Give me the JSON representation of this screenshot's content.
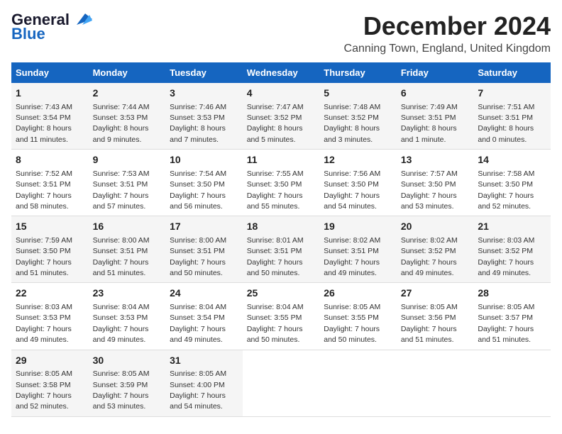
{
  "logo": {
    "line1": "General",
    "line2": "Blue"
  },
  "title": "December 2024",
  "location": "Canning Town, England, United Kingdom",
  "headers": [
    "Sunday",
    "Monday",
    "Tuesday",
    "Wednesday",
    "Thursday",
    "Friday",
    "Saturday"
  ],
  "weeks": [
    [
      {
        "day": "1",
        "sunrise": "7:43 AM",
        "sunset": "3:54 PM",
        "daylight": "8 hours and 11 minutes."
      },
      {
        "day": "2",
        "sunrise": "7:44 AM",
        "sunset": "3:53 PM",
        "daylight": "8 hours and 9 minutes."
      },
      {
        "day": "3",
        "sunrise": "7:46 AM",
        "sunset": "3:53 PM",
        "daylight": "8 hours and 7 minutes."
      },
      {
        "day": "4",
        "sunrise": "7:47 AM",
        "sunset": "3:52 PM",
        "daylight": "8 hours and 5 minutes."
      },
      {
        "day": "5",
        "sunrise": "7:48 AM",
        "sunset": "3:52 PM",
        "daylight": "8 hours and 3 minutes."
      },
      {
        "day": "6",
        "sunrise": "7:49 AM",
        "sunset": "3:51 PM",
        "daylight": "8 hours and 1 minute."
      },
      {
        "day": "7",
        "sunrise": "7:51 AM",
        "sunset": "3:51 PM",
        "daylight": "8 hours and 0 minutes."
      }
    ],
    [
      {
        "day": "8",
        "sunrise": "7:52 AM",
        "sunset": "3:51 PM",
        "daylight": "7 hours and 58 minutes."
      },
      {
        "day": "9",
        "sunrise": "7:53 AM",
        "sunset": "3:51 PM",
        "daylight": "7 hours and 57 minutes."
      },
      {
        "day": "10",
        "sunrise": "7:54 AM",
        "sunset": "3:50 PM",
        "daylight": "7 hours and 56 minutes."
      },
      {
        "day": "11",
        "sunrise": "7:55 AM",
        "sunset": "3:50 PM",
        "daylight": "7 hours and 55 minutes."
      },
      {
        "day": "12",
        "sunrise": "7:56 AM",
        "sunset": "3:50 PM",
        "daylight": "7 hours and 54 minutes."
      },
      {
        "day": "13",
        "sunrise": "7:57 AM",
        "sunset": "3:50 PM",
        "daylight": "7 hours and 53 minutes."
      },
      {
        "day": "14",
        "sunrise": "7:58 AM",
        "sunset": "3:50 PM",
        "daylight": "7 hours and 52 minutes."
      }
    ],
    [
      {
        "day": "15",
        "sunrise": "7:59 AM",
        "sunset": "3:50 PM",
        "daylight": "7 hours and 51 minutes."
      },
      {
        "day": "16",
        "sunrise": "8:00 AM",
        "sunset": "3:51 PM",
        "daylight": "7 hours and 51 minutes."
      },
      {
        "day": "17",
        "sunrise": "8:00 AM",
        "sunset": "3:51 PM",
        "daylight": "7 hours and 50 minutes."
      },
      {
        "day": "18",
        "sunrise": "8:01 AM",
        "sunset": "3:51 PM",
        "daylight": "7 hours and 50 minutes."
      },
      {
        "day": "19",
        "sunrise": "8:02 AM",
        "sunset": "3:51 PM",
        "daylight": "7 hours and 49 minutes."
      },
      {
        "day": "20",
        "sunrise": "8:02 AM",
        "sunset": "3:52 PM",
        "daylight": "7 hours and 49 minutes."
      },
      {
        "day": "21",
        "sunrise": "8:03 AM",
        "sunset": "3:52 PM",
        "daylight": "7 hours and 49 minutes."
      }
    ],
    [
      {
        "day": "22",
        "sunrise": "8:03 AM",
        "sunset": "3:53 PM",
        "daylight": "7 hours and 49 minutes."
      },
      {
        "day": "23",
        "sunrise": "8:04 AM",
        "sunset": "3:53 PM",
        "daylight": "7 hours and 49 minutes."
      },
      {
        "day": "24",
        "sunrise": "8:04 AM",
        "sunset": "3:54 PM",
        "daylight": "7 hours and 49 minutes."
      },
      {
        "day": "25",
        "sunrise": "8:04 AM",
        "sunset": "3:55 PM",
        "daylight": "7 hours and 50 minutes."
      },
      {
        "day": "26",
        "sunrise": "8:05 AM",
        "sunset": "3:55 PM",
        "daylight": "7 hours and 50 minutes."
      },
      {
        "day": "27",
        "sunrise": "8:05 AM",
        "sunset": "3:56 PM",
        "daylight": "7 hours and 51 minutes."
      },
      {
        "day": "28",
        "sunrise": "8:05 AM",
        "sunset": "3:57 PM",
        "daylight": "7 hours and 51 minutes."
      }
    ],
    [
      {
        "day": "29",
        "sunrise": "8:05 AM",
        "sunset": "3:58 PM",
        "daylight": "7 hours and 52 minutes."
      },
      {
        "day": "30",
        "sunrise": "8:05 AM",
        "sunset": "3:59 PM",
        "daylight": "7 hours and 53 minutes."
      },
      {
        "day": "31",
        "sunrise": "8:05 AM",
        "sunset": "4:00 PM",
        "daylight": "7 hours and 54 minutes."
      },
      null,
      null,
      null,
      null
    ]
  ]
}
